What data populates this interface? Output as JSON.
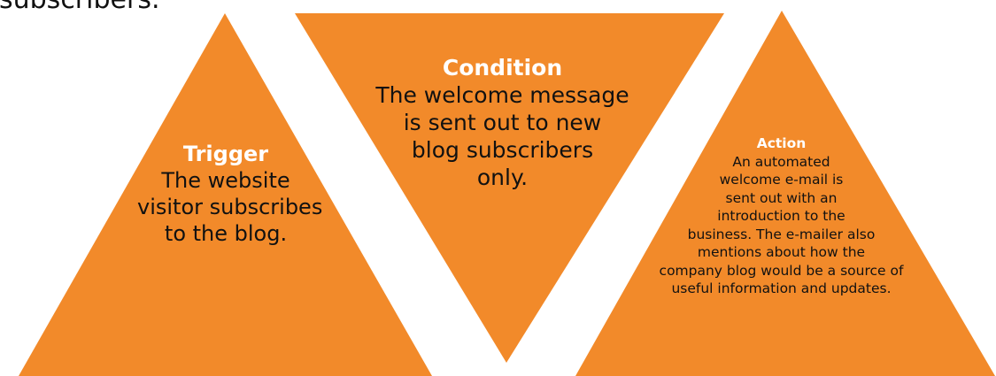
{
  "header": {
    "text": "subscribers."
  },
  "colors": {
    "shape_fill": "#F28A2A",
    "title_color": "#FFFFFF",
    "body_text_color": "#111111"
  },
  "shapes": [
    {
      "id": "trigger",
      "orientation": "up",
      "title": "Trigger",
      "lines": [
        "The website",
        "visitor subscribes",
        "to the blog."
      ]
    },
    {
      "id": "condition",
      "orientation": "down",
      "title": "Condition",
      "lines": [
        "The welcome message",
        "is sent out to new",
        "blog subscribers",
        "only."
      ]
    },
    {
      "id": "action",
      "orientation": "up",
      "title": "Action",
      "lines": [
        "An automated",
        "welcome e-mail is",
        "sent  out with an",
        "introduction to the",
        "business. The e-mailer also",
        "mentions about how the",
        "company blog would be a source of",
        "useful information and updates."
      ]
    }
  ]
}
